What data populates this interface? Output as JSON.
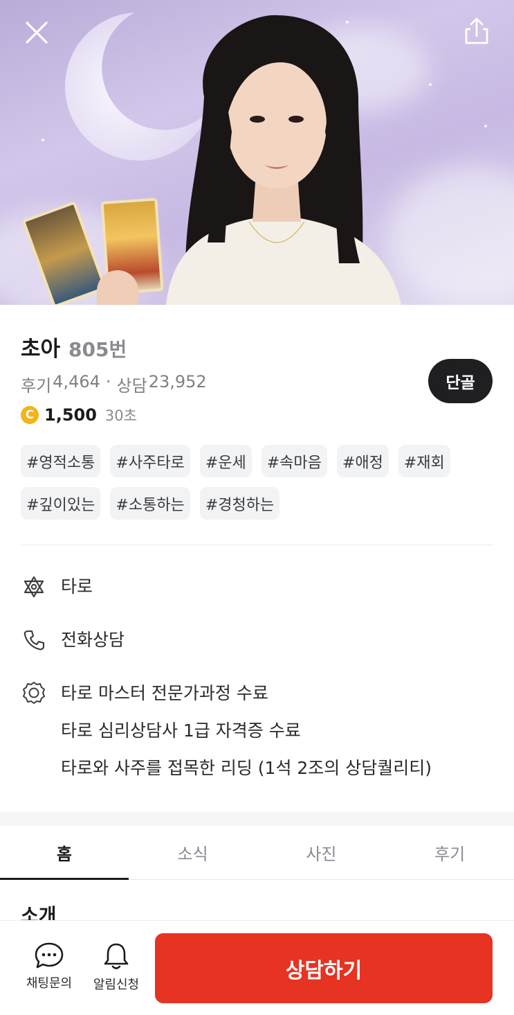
{
  "profile": {
    "name": "초아",
    "number": "805번",
    "reviews_label": "후기",
    "reviews_count": "4,464",
    "separator": "·",
    "consults_label": "상담",
    "consults_count": "23,952",
    "coin_symbol": "C",
    "price": "1,500",
    "per_unit": "30초",
    "favorite_label": "단골"
  },
  "tags": [
    "#영적소통",
    "#사주타로",
    "#운세",
    "#속마음",
    "#애정",
    "#재회",
    "#깊이있는",
    "#소통하는",
    "#경청하는"
  ],
  "details": {
    "category": "타로",
    "consult_type": "전화상담",
    "credentials": [
      "타로 마스터 전문가과정 수료",
      "타로 심리상담사 1급 자격증 수료",
      "타로와 사주를 접목한 리딩 (1석 2조의 상담퀄리티)"
    ]
  },
  "tabs": [
    "홈",
    "소식",
    "사진",
    "후기"
  ],
  "section_title": "소개",
  "bottom_bar": {
    "chat_label": "채팅문의",
    "alert_label": "알림신청",
    "cta_label": "상담하기"
  },
  "colors": {
    "cta": "#e63322",
    "coin": "#f5b316",
    "favorite_bg": "#1f1f21",
    "tag_bg": "#f2f3f5"
  },
  "icons": {
    "close": "close-icon",
    "share": "share-icon",
    "category": "star-of-david-icon",
    "consult_type": "phone-icon",
    "credentials": "award-badge-icon",
    "chat": "chat-bubble-icon",
    "alert": "bell-icon"
  }
}
